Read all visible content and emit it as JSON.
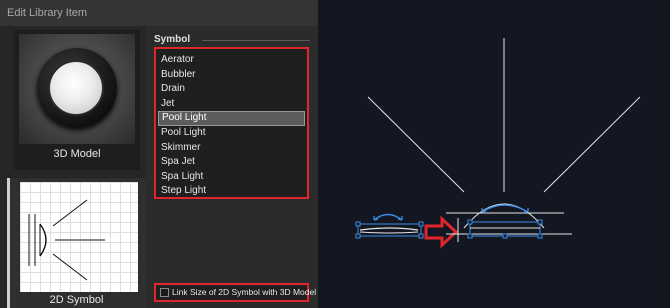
{
  "dialog": {
    "title": "Edit Library Item"
  },
  "thumbnails": {
    "model3d": {
      "label": "3D Model"
    },
    "symbol2d": {
      "label": "2D Symbol"
    }
  },
  "symbol": {
    "header": "Symbol",
    "items": [
      {
        "label": "Aerator"
      },
      {
        "label": "Bubbler"
      },
      {
        "label": "Drain"
      },
      {
        "label": "Jet"
      },
      {
        "label": "Pool Light",
        "selected": true
      },
      {
        "label": "Pool Light"
      },
      {
        "label": "Skimmer"
      },
      {
        "label": "Spa Jet"
      },
      {
        "label": "Spa Light"
      },
      {
        "label": "Step Light"
      }
    ],
    "link_size_label": "Link Size of 2D Symbol with 3D Model",
    "link_size_checked": false
  },
  "colors": {
    "highlight_box": "#e0262c",
    "cad_selection": "#3d8ee6",
    "cad_lines": "#e6e6e6",
    "viewport_bg": "#121722"
  }
}
